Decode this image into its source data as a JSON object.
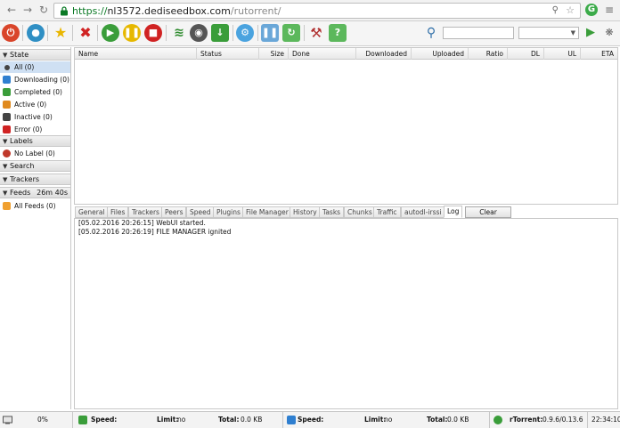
{
  "browser": {
    "url_scheme": "https://",
    "url_host": "nl3572.dediseedbox.com",
    "url_path": "/rutorrent/"
  },
  "toolbar": {
    "search_value": "",
    "filter_value": ""
  },
  "sidebar": {
    "state_label": "State",
    "state_items": [
      {
        "label": "All (0)"
      },
      {
        "label": "Downloading (0)"
      },
      {
        "label": "Completed (0)"
      },
      {
        "label": "Active (0)"
      },
      {
        "label": "Inactive (0)"
      },
      {
        "label": "Error (0)"
      }
    ],
    "labels_label": "Labels",
    "no_label": "No Label (0)",
    "search_label": "Search",
    "trackers_label": "Trackers",
    "feeds_label": "Feeds",
    "feeds_timer": "26m 40s",
    "all_feeds": "All Feeds (0)"
  },
  "table": {
    "columns": [
      "Name",
      "Status",
      "Size",
      "Done",
      "Downloaded",
      "Uploaded",
      "Ratio",
      "DL",
      "UL",
      "ETA"
    ]
  },
  "tabs": {
    "items": [
      "General",
      "Files",
      "Trackers",
      "Peers",
      "Speed",
      "Plugins",
      "File Manager",
      "History",
      "Tasks",
      "Chunks",
      "Traffic",
      "autodl-irssi",
      "Log"
    ],
    "clear_label": "Clear"
  },
  "log": {
    "lines": [
      "[05.02.2016 20:26:15] WebUI started.",
      "[05.02.2016 20:26:19] FILE MANAGER ignited"
    ]
  },
  "status": {
    "disk_percent": "0%",
    "dl_speed_label": "Speed:",
    "dl_limit_label": "Limit:",
    "dl_limit_value": "no",
    "dl_total_label": "Total:",
    "dl_total_value": "0.0 KB",
    "ul_speed_label": "Speed:",
    "ul_limit_label": "Limit:",
    "ul_limit_value": "no",
    "ul_total_label": "Total:",
    "ul_total_value": "0.0 KB",
    "rtorrent_label": "rTorrent:",
    "rtorrent_version": "0.9.6/0.13.6",
    "clock": "22:34:10"
  }
}
